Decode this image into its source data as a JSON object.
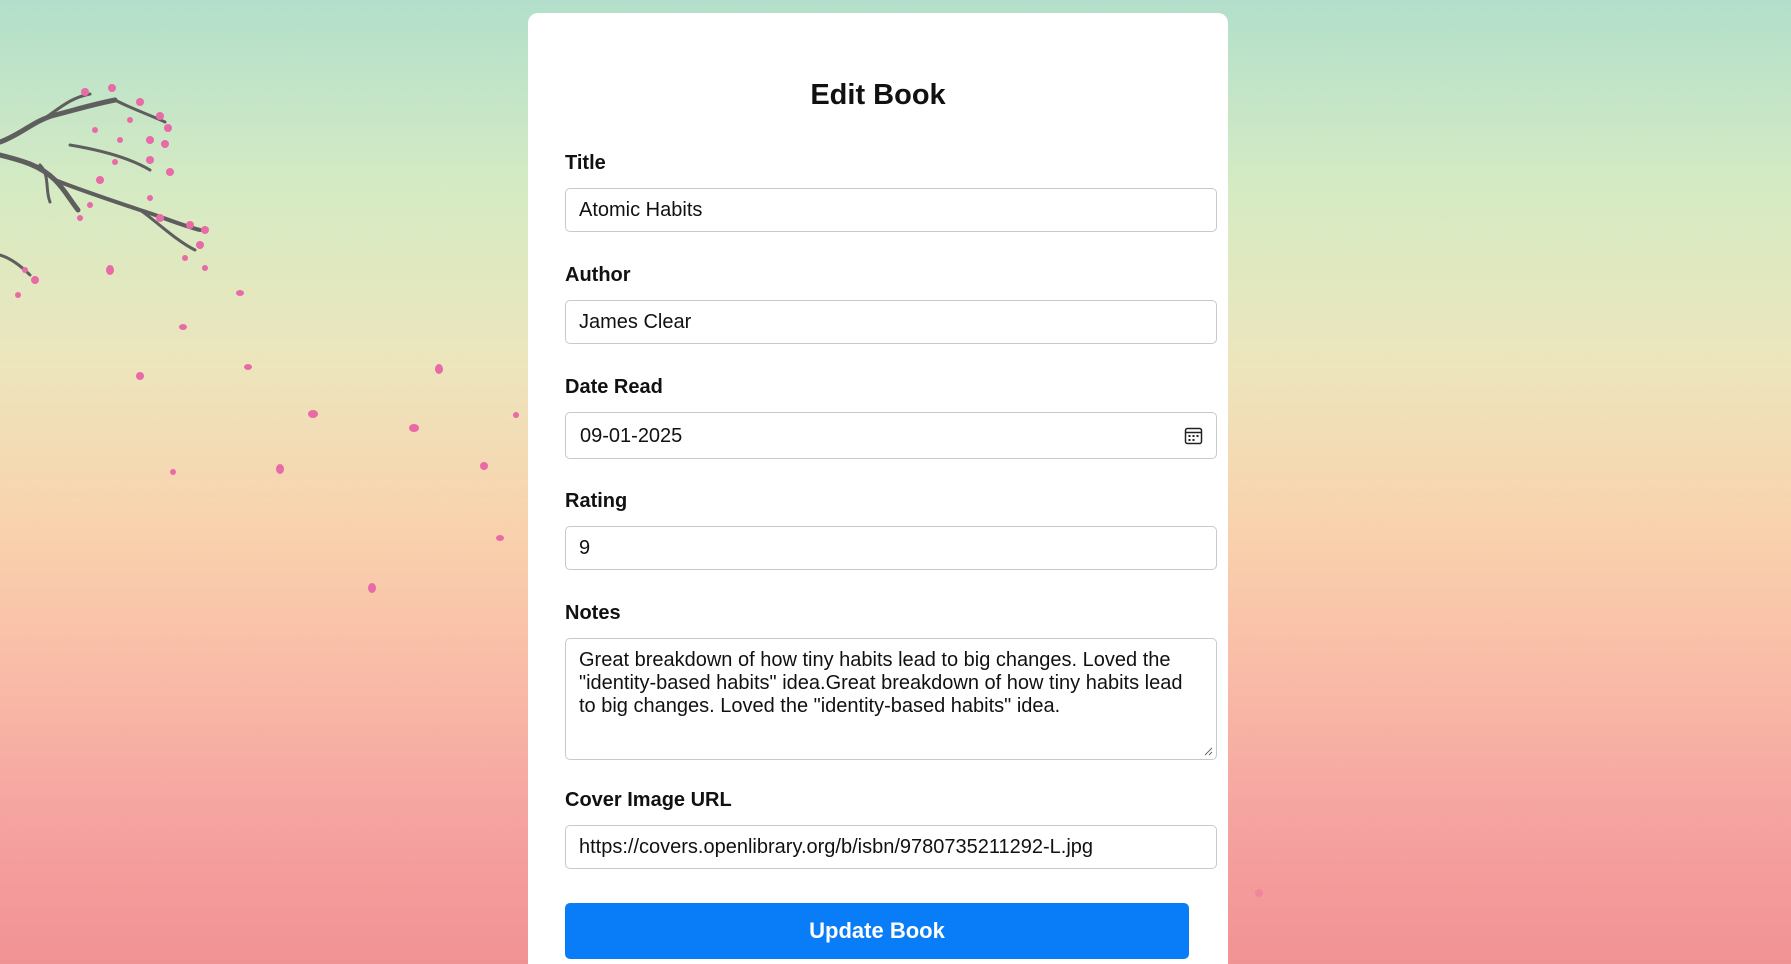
{
  "form": {
    "title": "Edit Book",
    "fields": {
      "title": {
        "label": "Title",
        "value": "Atomic Habits"
      },
      "author": {
        "label": "Author",
        "value": "James Clear"
      },
      "date_read": {
        "label": "Date Read",
        "value": "09-01-2025"
      },
      "rating": {
        "label": "Rating",
        "value": "9"
      },
      "notes": {
        "label": "Notes",
        "value": "Great breakdown of how tiny habits lead to big changes. Loved the \"identity-based habits\" idea.Great breakdown of how tiny habits lead to big changes. Loved the \"identity-based habits\" idea."
      },
      "cover_url": {
        "label": "Cover Image URL",
        "value": "https://covers.openlibrary.org/b/isbn/9780735211292-L.jpg"
      }
    },
    "submit_label": "Update Book"
  },
  "theme": {
    "button_color": "#087df7",
    "petal_color": "#e86aa6",
    "branch_color": "#5e5e5e"
  },
  "icons": {
    "date_picker": "calendar-icon",
    "textarea_resize": "resize-grip-icon",
    "background": "cherry-blossom-branch"
  }
}
